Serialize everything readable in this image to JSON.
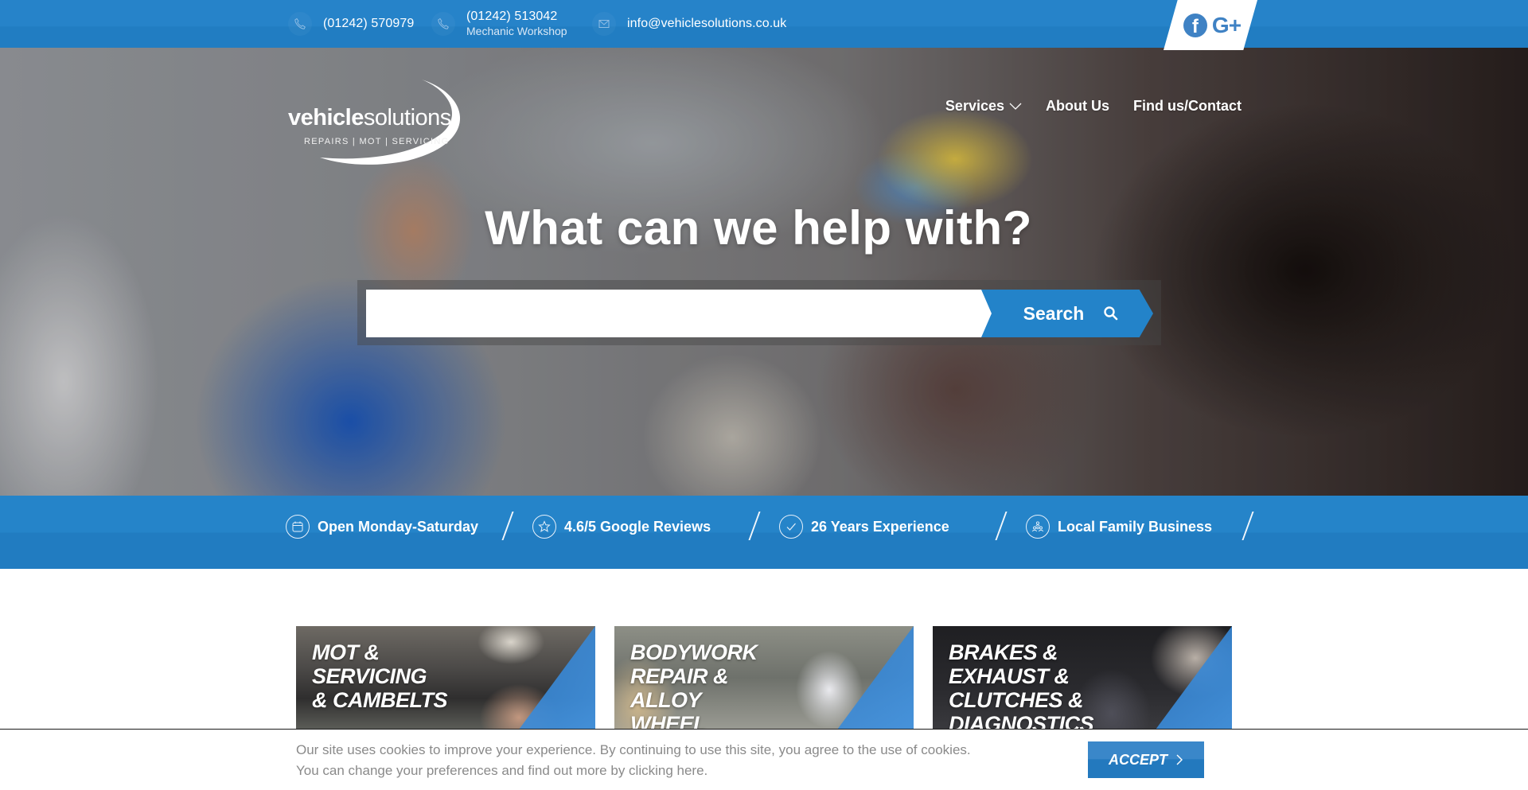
{
  "brand": {
    "name_bold": "vehicle",
    "name_light": "solutions",
    "tagline": "REPAIRS | MOT | SERVICING",
    "accent_color": "#2383c9"
  },
  "topbar": {
    "contacts": [
      {
        "icon": "phone-icon",
        "text": "(01242) 570979"
      },
      {
        "icon": "phone-icon",
        "text": "(01242) 513042",
        "subtext": "Mechanic Workshop"
      },
      {
        "icon": "mail-icon",
        "text": "info@vehiclesolutions.co.uk"
      }
    ],
    "social": [
      {
        "icon": "facebook-icon",
        "glyph": "f"
      },
      {
        "icon": "google-plus-icon",
        "glyph": "G+"
      }
    ]
  },
  "nav": {
    "items": [
      {
        "label": "Services",
        "has_dropdown": true
      },
      {
        "label": "About Us"
      },
      {
        "label": "Find us/Contact"
      }
    ]
  },
  "hero": {
    "title": "What can we help with?",
    "search": {
      "value": "",
      "placeholder": "",
      "button_label": "Search"
    }
  },
  "features": [
    {
      "icon": "calendar-icon",
      "label": "Open Monday-Saturday"
    },
    {
      "icon": "star-icon",
      "label": "4.6/5 Google Reviews"
    },
    {
      "icon": "check-icon",
      "label": "26 Years Experience"
    },
    {
      "icon": "family-icon",
      "label": "Local Family Business"
    }
  ],
  "services": [
    {
      "title_lines": [
        "MOT &",
        "SERVICING",
        "& CAMBELTS"
      ]
    },
    {
      "title_lines": [
        "BODYWORK",
        "REPAIR &",
        "ALLOY",
        "WHEEL"
      ]
    },
    {
      "title_lines": [
        "BRAKES &",
        "EXHAUST &",
        "CLUTCHES &",
        "DIAGNOSTICS"
      ]
    }
  ],
  "cookie": {
    "message_line1": "Our site uses cookies to improve your experience. By continuing to use this site, you agree to the use of cookies.",
    "message_line2": "You can change your preferences and find out more by clicking here.",
    "accept_label": "ACCEPT"
  }
}
